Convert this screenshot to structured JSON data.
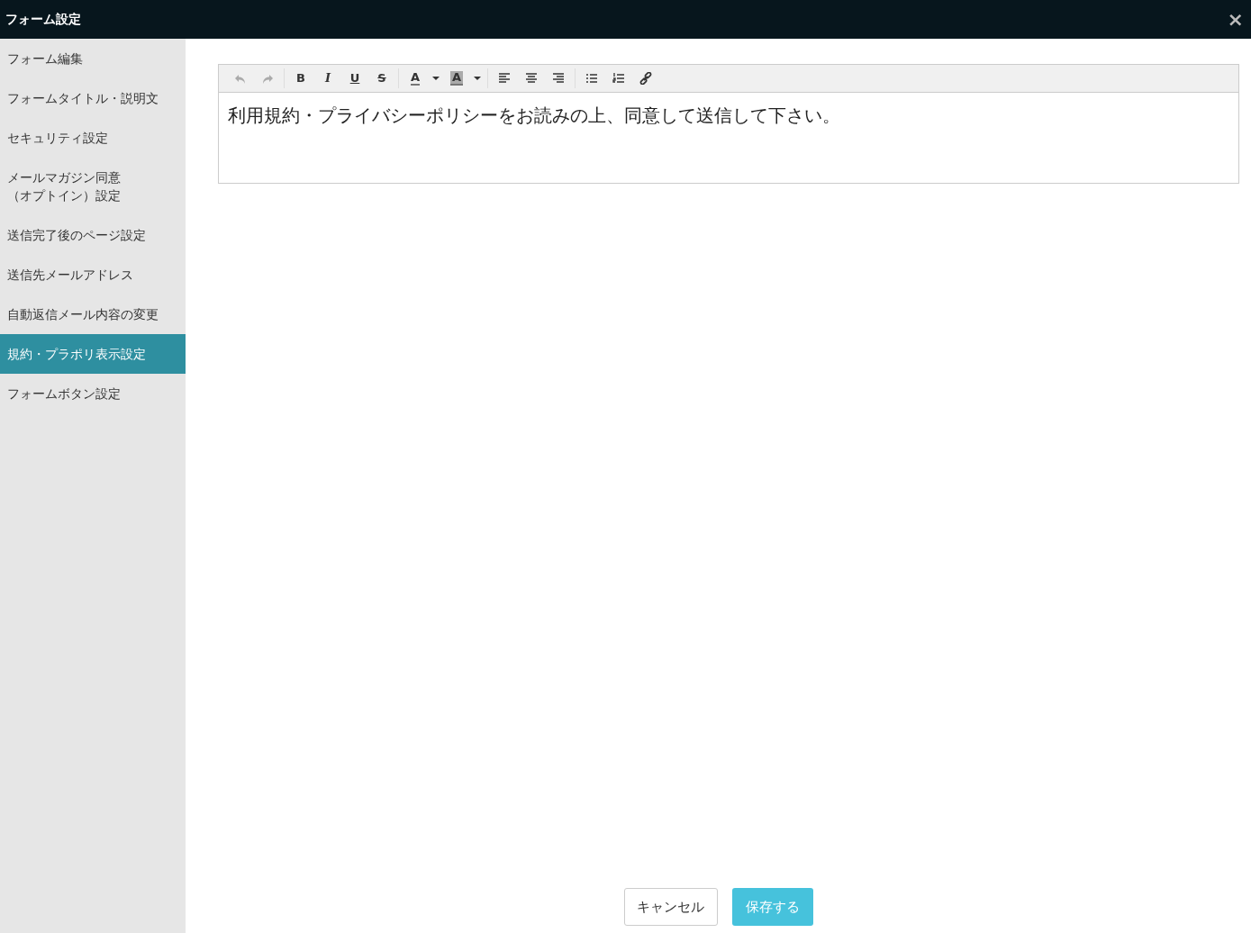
{
  "window": {
    "title": "フォーム設定",
    "close": "×"
  },
  "sidebar": {
    "items": [
      {
        "label": "フォーム編集",
        "selected": false
      },
      {
        "label": "フォームタイトル・説明文",
        "selected": false
      },
      {
        "label": "セキュリティ設定",
        "selected": false
      },
      {
        "lines": [
          "メールマガジン同意",
          "（オプトイン）設定"
        ],
        "selected": false
      },
      {
        "label": "送信完了後のページ設定",
        "selected": false
      },
      {
        "label": "送信先メールアドレス",
        "selected": false
      },
      {
        "label": "自動返信メール内容の変更",
        "selected": false
      },
      {
        "label": "規約・プラポリ表示設定",
        "selected": true
      },
      {
        "label": "フォームボタン設定",
        "selected": false
      }
    ]
  },
  "editor": {
    "toolbar": [
      [
        {
          "kind": "undo",
          "disabled": true
        },
        {
          "kind": "redo",
          "disabled": true
        }
      ],
      [
        {
          "kind": "bold",
          "label": "B"
        },
        {
          "kind": "italic",
          "label": "I"
        },
        {
          "kind": "underline",
          "label": "U"
        },
        {
          "kind": "strike",
          "label": "S"
        }
      ],
      [
        {
          "kind": "forecolor",
          "label": "A"
        },
        {
          "kind": "caret"
        },
        {
          "kind": "backcolor",
          "label": "A"
        },
        {
          "kind": "caret"
        }
      ],
      [
        {
          "kind": "align-left"
        },
        {
          "kind": "align-center"
        },
        {
          "kind": "align-right"
        }
      ],
      [
        {
          "kind": "bullets"
        },
        {
          "kind": "numbers"
        },
        {
          "kind": "link"
        }
      ]
    ],
    "content": "利用規約・プライバシーポリシーをお読みの上、同意して送信して下さい。"
  },
  "buttons": [
    {
      "kind": "cancel",
      "label": "キャンセル"
    },
    {
      "kind": "save",
      "label": "保存する"
    }
  ]
}
